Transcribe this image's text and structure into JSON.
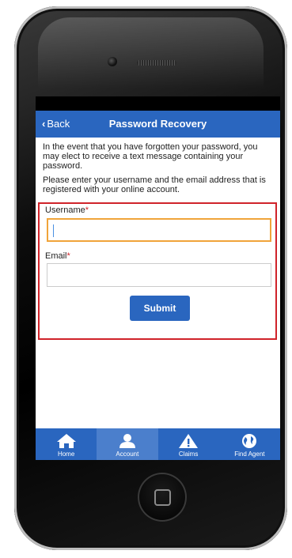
{
  "nav": {
    "back_label": "Back",
    "title": "Password Recovery"
  },
  "content": {
    "paragraph1": "In the event that you have forgotten your password, you may elect to receive a text message containing your password.",
    "paragraph2": "Please enter your username and the email address that is registered with your online account."
  },
  "form": {
    "username_label": "Username",
    "email_label": "Email",
    "required_mark": "*",
    "username_value": "",
    "email_value": "",
    "submit_label": "Submit"
  },
  "tabs": [
    {
      "label": "Home",
      "icon": "home-icon"
    },
    {
      "label": "Account",
      "icon": "account-icon",
      "active": true
    },
    {
      "label": "Claims",
      "icon": "warning-icon"
    },
    {
      "label": "Find Agent",
      "icon": "globe-icon"
    }
  ],
  "colors": {
    "primary": "#2a66bf",
    "required": "#d0232a",
    "focus": "#f0a43a"
  }
}
